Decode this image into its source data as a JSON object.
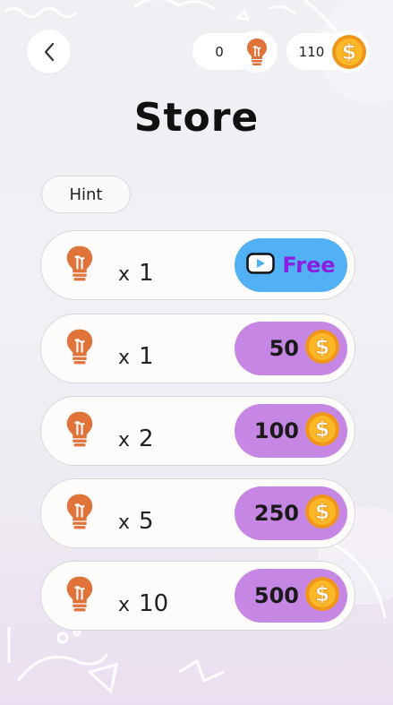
{
  "header": {
    "title": "Store",
    "hints_count": "0",
    "coins_count": "110"
  },
  "section": {
    "label": "Hint"
  },
  "offers": [
    {
      "quantity": "1",
      "price": "Free",
      "type": "ad"
    },
    {
      "quantity": "1",
      "price": "50",
      "type": "coins"
    },
    {
      "quantity": "2",
      "price": "100",
      "type": "coins"
    },
    {
      "quantity": "5",
      "price": "250",
      "type": "coins"
    },
    {
      "quantity": "10",
      "price": "500",
      "type": "coins"
    }
  ],
  "multiplier_symbol": "x",
  "colors": {
    "bulb": "#e0733a",
    "coin": "#f5a623",
    "free_button": "#52b0f4",
    "coin_button": "#c687e4",
    "free_text": "#8b1fe0"
  },
  "icons": {
    "back": "chevron-left-icon",
    "hint": "lightbulb-icon",
    "coin": "dollar-coin-icon",
    "video": "play-video-icon"
  }
}
